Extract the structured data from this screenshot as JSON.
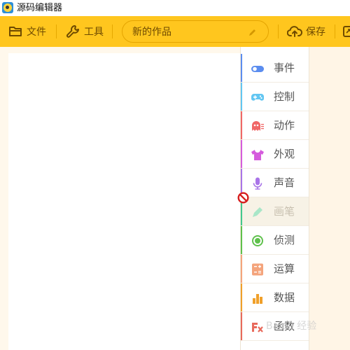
{
  "window": {
    "title": "源码编辑器",
    "icon": "app-logo-icon"
  },
  "toolbar": {
    "file_label": "文件",
    "tools_label": "工具",
    "project_name": "新的作品",
    "save_label": "保存",
    "icons": [
      "folder-icon",
      "wrench-icon",
      "pencil-icon",
      "cloud-upload-icon",
      "share-icon"
    ]
  },
  "categories": [
    {
      "label": "事件",
      "icon": "toggle-icon",
      "color": "#5b8def",
      "disabled": false
    },
    {
      "label": "控制",
      "icon": "gamepad-icon",
      "color": "#62c6f2",
      "disabled": false
    },
    {
      "label": "动作",
      "icon": "ghost-icon",
      "color": "#f06767",
      "disabled": false
    },
    {
      "label": "外观",
      "icon": "shirt-icon",
      "color": "#d55cdd",
      "disabled": false
    },
    {
      "label": "声音",
      "icon": "microphone-icon",
      "color": "#a974e8",
      "disabled": false
    },
    {
      "label": "画笔",
      "icon": "paint-icon",
      "color": "#44c98e",
      "disabled": true
    },
    {
      "label": "侦测",
      "icon": "target-icon",
      "color": "#5fc14c",
      "disabled": false
    },
    {
      "label": "运算",
      "icon": "calculator-icon",
      "color": "#f4a47c",
      "disabled": false
    },
    {
      "label": "数据",
      "icon": "bar-chart-icon",
      "color": "#f0a02a",
      "disabled": false
    },
    {
      "label": "函数",
      "icon": "function-icon",
      "color": "#e86a5c",
      "disabled": false
    }
  ],
  "watermark": "Baidu 经验"
}
